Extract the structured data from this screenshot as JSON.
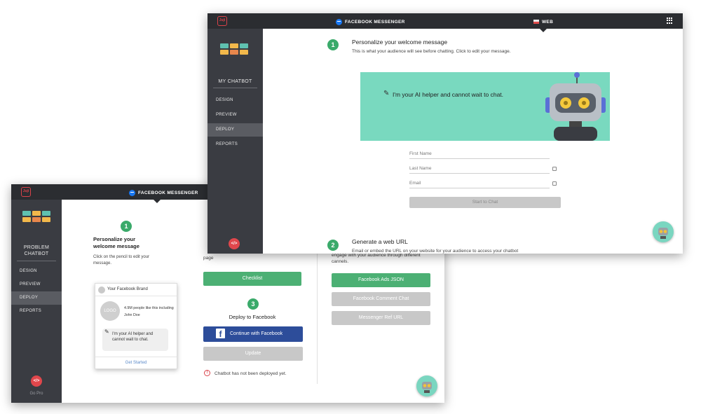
{
  "brand": {
    "logo_text": "Juji"
  },
  "back_window": {
    "tab_label": "FACEBOOK MESSENGER",
    "sidebar": {
      "title_line1": "PROBLEM",
      "title_line2": "CHATBOT",
      "items": [
        {
          "label": "DESIGN"
        },
        {
          "label": "PREVIEW"
        },
        {
          "label": "DEPLOY"
        },
        {
          "label": "REPORTS"
        }
      ],
      "code_label": "</>",
      "gopro_label": "Go Pro"
    },
    "step1": {
      "number": "1",
      "title": "Personalize your welcome message",
      "desc": "Click on the pencil to edit your message."
    },
    "fb_card": {
      "brand_name": "Your Facebook Brand",
      "logo_text": "LOGO",
      "likes_text": "4.9M people like this including John Doe",
      "bubble_text": "I'm your AI helper and cannot wait to chat.",
      "link_text": "Get Started"
    },
    "page_fragment": "page",
    "checklist_label": "Checklist",
    "step3": {
      "number": "3",
      "title": "Deploy to Facebook"
    },
    "continue_fb_label": "Continue with Facebook",
    "update_label": "Update",
    "status_text": "Chatbot has not been deployed yet.",
    "right_col": {
      "desc": "engage with your audience through different cannels.",
      "buttons": [
        {
          "label": "Facebook Ads JSON"
        },
        {
          "label": "Facebook Comment Chat"
        },
        {
          "label": "Messenger Ref URL"
        }
      ]
    }
  },
  "front_window": {
    "tab_label": "FACEBOOK MESSENGER",
    "tab_web_label": "WEB",
    "sidebar": {
      "title": "MY CHATBOT",
      "items": [
        {
          "label": "DESIGN"
        },
        {
          "label": "PREVIEW"
        },
        {
          "label": "DEPLOY"
        },
        {
          "label": "REPORTS"
        }
      ],
      "code_label": "</>"
    },
    "step1": {
      "number": "1",
      "title": "Personalize your welcome message",
      "desc": "This is what your audience will see before chatting. Click to edit your message."
    },
    "banner_text": "I'm your AI helper and cannot wait to chat.",
    "form": {
      "first_name": "First Name",
      "last_name": "Last Name",
      "email": "Email",
      "start_label": "Start to Chat"
    },
    "step2": {
      "number": "2",
      "title": "Generate a web URL",
      "desc": "Email or embed the URL on your website for your audience to access your chatbot"
    }
  },
  "colors": {
    "topbar": "#2b2d31",
    "sidebar": "#3a3c42",
    "accent_green": "#4cb074",
    "step_green": "#3aaa6a",
    "banner_teal": "#79d9bf",
    "facebook_blue": "#2d4d9a",
    "code_red": "#e0474c"
  }
}
